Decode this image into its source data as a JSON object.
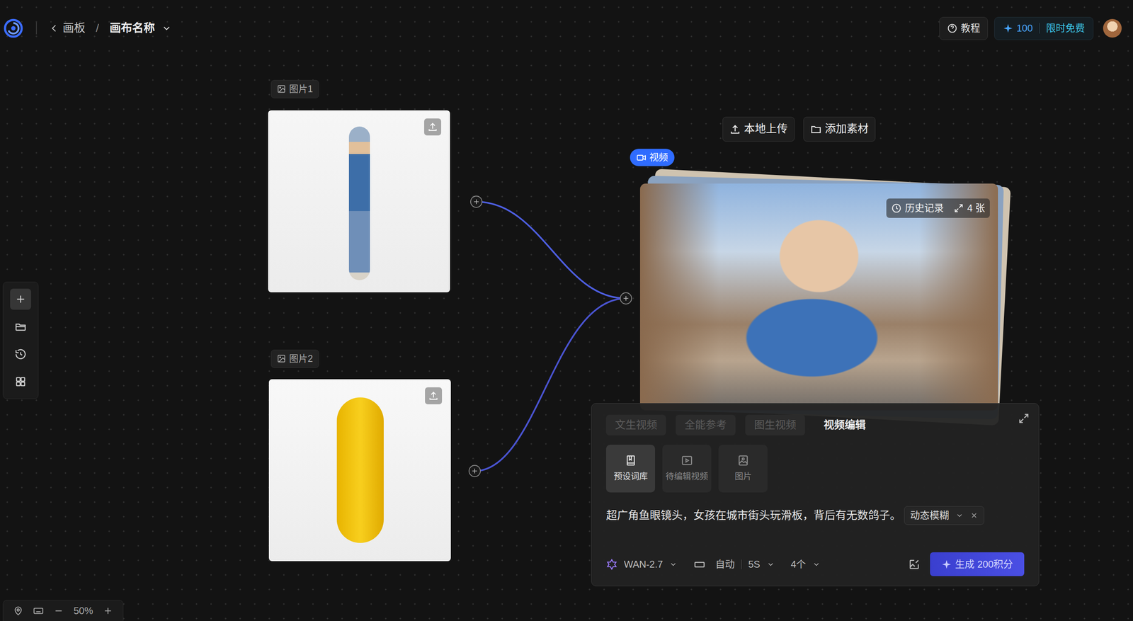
{
  "topbar": {
    "back": "画板",
    "separator": "/",
    "canvas_name": "画布名称",
    "tutorial": "教程",
    "credits": "100",
    "promo": "限时免费"
  },
  "toolbar": [
    {
      "selected": true
    },
    {
      "selected": false
    },
    {
      "selected": false
    },
    {
      "selected": false
    }
  ],
  "zoom": {
    "level": "50%"
  },
  "nodes": [
    {
      "label": "图片1"
    },
    {
      "label": "图片2"
    }
  ],
  "video_node": {
    "upload": "本地上传",
    "add_material": "添加素材",
    "badge": "视频",
    "history": "历史记录",
    "count": "4 张"
  },
  "editor": {
    "tabs": [
      {
        "label": "文生视频",
        "selected": false
      },
      {
        "label": "全能参考",
        "selected": false
      },
      {
        "label": "图生视频",
        "selected": false
      },
      {
        "label": "视频编辑",
        "selected": true
      }
    ],
    "sources": [
      {
        "label": "预设词库",
        "selected": true
      },
      {
        "label": "待编辑视频",
        "selected": false
      },
      {
        "label": "图片",
        "selected": false
      }
    ],
    "prompt": "超广角鱼眼镜头，女孩在城市街头玩滑板，背后有无数鸽子。",
    "chip": {
      "label": "动态模糊"
    },
    "model": "WAN-2.7",
    "ratio": "自动",
    "duration": "5S",
    "count": "4个",
    "generate": "生成 200积分"
  }
}
